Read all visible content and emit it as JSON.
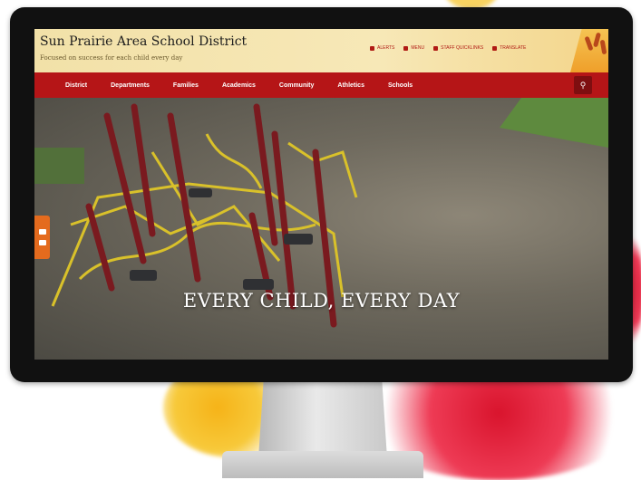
{
  "site": {
    "title": "Sun Prairie Area School District",
    "tagline": "Focused on success for each child every day"
  },
  "utility_links": [
    {
      "label": "ALERTS",
      "icon": "bell-icon"
    },
    {
      "label": "MENU",
      "icon": "menu-icon"
    },
    {
      "label": "STAFF QUICKLINKS",
      "icon": "link-icon"
    },
    {
      "label": "TRANSLATE",
      "icon": "globe-icon"
    }
  ],
  "nav": {
    "items": [
      "District",
      "Departments",
      "Families",
      "Academics",
      "Community",
      "Athletics",
      "Schools"
    ],
    "search_icon": "search-icon"
  },
  "hero": {
    "headline": "EVERY CHILD, EVERY DAY"
  },
  "colors": {
    "header_bg": "#f2e1a8",
    "nav_bg": "#b51517",
    "accent_orange": "#e46b1e",
    "splash_red": "#d9142d",
    "splash_yellow": "#f6b318"
  }
}
